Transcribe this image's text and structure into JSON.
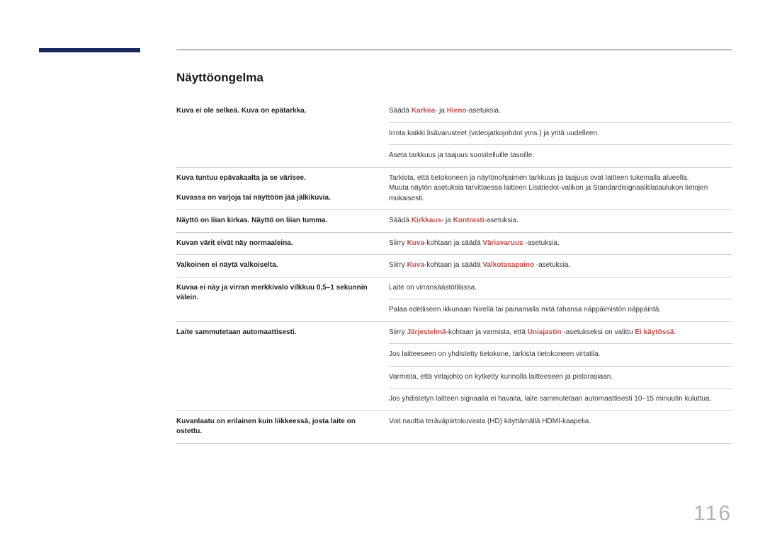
{
  "heading": "Näyttöongelma",
  "page_number": "116",
  "rows": [
    {
      "label": "Kuva ei ole selkeä. Kuva on epätarkka.",
      "label_rowspan": 3,
      "solutions": [
        {
          "pre": "Säädä ",
          "hl1": "Karkea",
          "mid": "- ja ",
          "hl2": "Hieno",
          "post": "-asetuksia."
        },
        {
          "plain": "Irrota kaikki lisävarusteet (videojatkojohdot yms.) ja yritä uudelleen."
        },
        {
          "plain": "Aseta tarkkuus ja taajuus suositelluille tasoille."
        }
      ]
    },
    {
      "label_a": "Kuva tuntuu epävakaalta ja se värisee.",
      "label_b": "Kuvassa on varjoja tai näyttöön jää jälkikuvia.",
      "solutions": [
        {
          "line1": "Tarkista, että tietokoneen ja näytönohjaimen tarkkuus ja taajuus ovat laitteen tukemalla alueella.",
          "line2": "Muuta näytön asetuksia tarvittaessa laitteen Lisätiedot-valikon ja Standardisignaalitilataulukon tietojen mukaisesti."
        }
      ]
    },
    {
      "label": "Näyttö on liian kirkas. Näyttö on liian tumma.",
      "solutions": [
        {
          "pre": "Säädä ",
          "hl1": "Kirkkaus",
          "mid": "- ja ",
          "hl2": "Kontrasti",
          "post": "-asetuksia."
        }
      ]
    },
    {
      "label": "Kuvan värit eivät näy normaaleina.",
      "solutions": [
        {
          "pre": "Siirry ",
          "hl1": "Kuva",
          "mid": "-kohtaan ja säädä ",
          "hl2": "Väriavaruus",
          "post": " -asetuksia."
        }
      ]
    },
    {
      "label": "Valkoinen ei näytä valkoiselta.",
      "solutions": [
        {
          "pre": "Siirry ",
          "hl1": "Kuva",
          "mid": "-kohtaan ja säädä ",
          "hl2": "Valkotasapaino",
          "post": " -asetuksia."
        }
      ]
    },
    {
      "label": "Kuvaa ei näy ja virran merkkivalo vilkkuu 0,5–1 sekunnin välein.",
      "label_rowspan": 2,
      "solutions": [
        {
          "plain": "Laite on virransäästötilassa."
        },
        {
          "plain": "Palaa edelliseen ikkunaan hiirellä tai painamalla mitä tahansa näppäimistön näppäintä."
        }
      ]
    },
    {
      "label": "Laite sammutetaan automaattisesti.",
      "label_rowspan": 4,
      "solutions": [
        {
          "pre": "Siirry ",
          "hl1": "Järjestelmä",
          "mid": "-kohtaan ja varmista, että ",
          "hl2": "Uniajastin",
          "mid2": " -asetukseksi on valittu ",
          "hl3": "Ei käytössä",
          "post": "."
        },
        {
          "plain": "Jos laitteeseen on yhdistetty tietokone, tarkista tietokoneen virtatila."
        },
        {
          "plain": "Varmista, että virtajohto on kytketty kunnolla laitteeseen ja pistorasiaan."
        },
        {
          "plain": "Jos yhdistetyn laitteen signaalia ei havaita, laite sammutetaan automaattisesti 10–15 minuutin kuluttua."
        }
      ]
    },
    {
      "label": "Kuvanlaatu on erilainen kuin liikkeessä, josta laite on ostettu.",
      "solutions": [
        {
          "plain": "Voit nauttia teräväpiirtokuvasta (HD) käyttämällä HDMI-kaapelia."
        }
      ]
    }
  ]
}
